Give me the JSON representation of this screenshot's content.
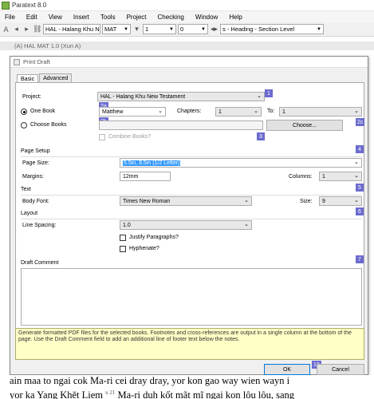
{
  "app": {
    "title": "Paratext 8.0"
  },
  "menu": [
    "File",
    "Edit",
    "View",
    "Insert",
    "Tools",
    "Project",
    "Checking",
    "Window",
    "Help"
  ],
  "toolbar": {
    "project_label": "HAL - Halang Khu N",
    "book": "MAT",
    "chapter": "1",
    "verse": "0",
    "style": "s - Heading - Section Level"
  },
  "child_window": {
    "title": "(A) HAL MAT 1.0 (Xun A)"
  },
  "dialog": {
    "title": "Print Draft",
    "tabs": [
      "Basic",
      "Advanced"
    ],
    "project_label": "Project:",
    "project_value": "HAL -  Halang Khu New Testament",
    "one_book_label": "One Book",
    "book_value": "Matthew",
    "chapters_label": "Chapters:",
    "chapter_from": "1",
    "to_label": "To:",
    "chapter_to": "1",
    "choose_books_label": "Choose Books",
    "choose_button": "Choose...",
    "combine_books_label": "Combine Books?",
    "page_setup_section": "Page Setup",
    "page_size_label": "Page Size:",
    "page_size_value": "5.5in, 8.5in (1/2 Letter)",
    "margins_label": "Margins:",
    "margins_value": "12mm",
    "columns_label": "Columns:",
    "columns_value": "1",
    "text_section": "Text",
    "body_font_label": "Body Font:",
    "body_font_value": "Times New Roman",
    "size_label": "Size:",
    "size_value": "9",
    "layout_section": "Layout",
    "line_spacing_label": "Line Spacing:",
    "line_spacing_value": "1.0",
    "justify_label": "Justify Paragraphs?",
    "hyphenate_label": "Hyphenate?",
    "draft_comment_section": "Draft Comment",
    "help_text": "Generate formatted PDF files for the selected books. Footnotes and cross-references are output in a single column at the bottom of the page. Use the Draft Comment field to add an additional line of footer text below the notes.",
    "ok_button": "OK",
    "cancel_button": "Cancel",
    "badges": [
      "1",
      "2a",
      "2b",
      "2c",
      "3",
      "4",
      "5",
      "6",
      "7",
      "10"
    ]
  },
  "background": {
    "line1": "ain maa to  ngai cok Ma-ri cei dray dray, yor kon gao  way wien  wayn i",
    "line2_a": "yor ka Yang Khět Liem",
    "line2_sup": "u 21",
    "line2_b": " Ma-ri duh kốt mãt mĩ ngai kon lôu lôu, sang"
  },
  "colors": {
    "badge": "#6b6bcf",
    "help_bg": "#ffffc6",
    "selection": "#3399ff"
  }
}
